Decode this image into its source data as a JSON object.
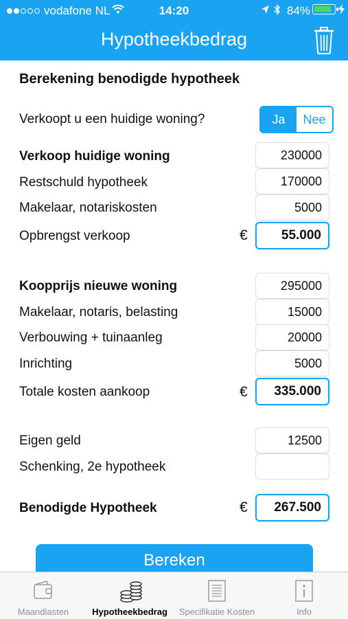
{
  "status": {
    "carrier": "vodafone NL",
    "time": "14:20",
    "battery": "84%"
  },
  "nav": {
    "title": "Hypotheekbedrag"
  },
  "section_title": "Berekening benodigde hypotheek",
  "sell_question": {
    "label": "Verkoopt u een huidige woning?",
    "options": [
      "Ja",
      "Nee"
    ],
    "selected": "Ja"
  },
  "sale": {
    "price_label": "Verkoop huidige woning",
    "price_value": "230000",
    "debt_label": "Restschuld hypotheek",
    "debt_value": "170000",
    "costs_label": "Makelaar, notariskosten",
    "costs_value": "5000",
    "total_label": "Opbrengst verkoop",
    "total_value": "55.000"
  },
  "purchase": {
    "price_label": "Koopprijs nieuwe woning",
    "price_value": "295000",
    "costs_label": "Makelaar, notaris, belasting",
    "costs_value": "15000",
    "renovation_label": "Verbouwing + tuinaanleg",
    "renovation_value": "20000",
    "furnishing_label": "Inrichting",
    "furnishing_value": "5000",
    "total_label": "Totale kosten aankoop",
    "total_value": "335.000"
  },
  "funding": {
    "own_label": "Eigen geld",
    "own_value": "12500",
    "gift_label": "Schenking, 2e hypotheek",
    "gift_value": "",
    "required_label": "Benodigde Hypotheek",
    "required_value": "267.500"
  },
  "currency_symbol": "€",
  "calculate_label": "Bereken",
  "tabs": [
    {
      "label": "Maandlasten",
      "icon": "wallet-icon"
    },
    {
      "label": "Hypotheekbedrag",
      "icon": "coins-icon",
      "active": true
    },
    {
      "label": "Specifikatie Kosten",
      "icon": "document-icon"
    },
    {
      "label": "Info",
      "icon": "info-icon"
    }
  ],
  "colors": {
    "accent": "#1aa3f1",
    "battery": "#4cd964"
  }
}
